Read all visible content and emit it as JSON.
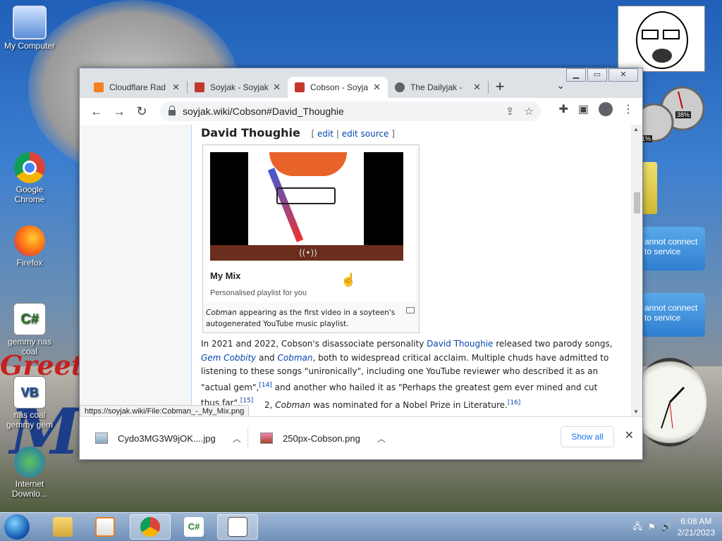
{
  "desktop": {
    "icons": [
      {
        "label": "My Computer"
      },
      {
        "label": "Google Chrome"
      },
      {
        "label": "Firefox"
      },
      {
        "label": "gemmy nas coal"
      },
      {
        "label": "nas coal gemmy gem"
      },
      {
        "label": "Internet Downlo..."
      }
    ],
    "wallpaper_text": [
      "Greeta",
      "M"
    ],
    "gadgets": {
      "cpu_meter_percent": "38%",
      "cpu_meter_other": "1%",
      "notices": [
        {
          "text": "annot connect to service"
        },
        {
          "text": "annot connect to service"
        }
      ]
    }
  },
  "browser": {
    "tabs": [
      {
        "title": "Cloudflare Rad",
        "active": false,
        "fav_color": "#f48120"
      },
      {
        "title": "Soyjak - Soyjak",
        "active": false,
        "fav_color": "#c0392b"
      },
      {
        "title": "Cobson - Soyja",
        "active": true,
        "fav_color": "#c0392b"
      },
      {
        "title": "The Dailyjak -",
        "active": false,
        "fav_color": "#5f6368"
      }
    ],
    "new_tab": "+",
    "url": "soyjak.wiki/Cobson#David_Thoughie",
    "status_url": "https://soyjak.wiki/File:Cobman_-_My_Mix.png"
  },
  "page": {
    "heading": "David Thoughie",
    "edit": "edit",
    "edit_source": "edit source",
    "video_title": "My Mix",
    "video_subtitle": "Personalised playlist for you",
    "caption_em": "Cobman",
    "caption_rest": " appearing as the first video in a soyteen's autogenerated YouTube music playlist.",
    "para1": {
      "t1": "In 2021 and 2022, Cobson's disassociate personality ",
      "link1": "David Thoughie",
      "t2": " released two parody songs, ",
      "link2": "Gem Cobbity",
      "t3": " and ",
      "link3": "Cobman",
      "t4": ", both to widespread critical acclaim. Multiple chuds have admitted to listening to these songs \"unironically\", including one YouTube reviewer who described it as an \"actual gem\",",
      "ref1": "[14]",
      "t5": " and another who hailed it as \"Perhaps the greatest gem ever mined and cut thus far\".",
      "ref2": "[15]"
    },
    "para2": {
      "t1": "2, ",
      "em": "Cobman",
      "t2": " was nominated for a Nobel Prize in Literature.",
      "ref": "[16]"
    }
  },
  "downloads": {
    "items": [
      {
        "name": "Cydo3MG3W9jOK....jpg"
      },
      {
        "name": "250px-Cobson.png"
      }
    ],
    "show_all": "Show all"
  },
  "taskbar": {
    "time": "6:08 AM",
    "date": "2/21/2023"
  },
  "colors": {
    "link": "#0645ad",
    "accent": "#1a73e8"
  }
}
